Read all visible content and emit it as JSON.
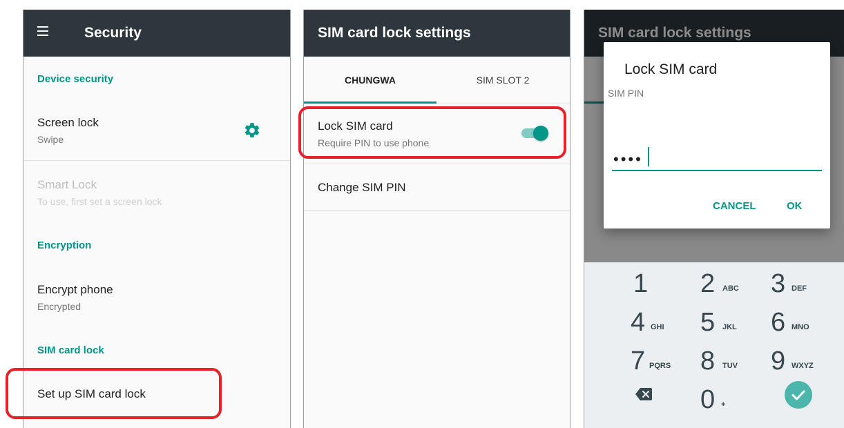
{
  "panel1": {
    "title": "Security",
    "section_device_security": "Device security",
    "screen_lock": {
      "title": "Screen lock",
      "subtitle": "Swipe"
    },
    "smart_lock": {
      "title": "Smart Lock",
      "subtitle": "To use, first set a screen lock"
    },
    "section_encryption": "Encryption",
    "encrypt_phone": {
      "title": "Encrypt phone",
      "subtitle": "Encrypted"
    },
    "section_sim_card_lock": "SIM card lock",
    "set_up_sim_lock": "Set up SIM card lock"
  },
  "panel2": {
    "title": "SIM card lock settings",
    "tabs": [
      {
        "label": "CHUNGWA",
        "selected": true
      },
      {
        "label": "SIM SLOT 2",
        "selected": false
      }
    ],
    "lock_sim": {
      "title": "Lock SIM card",
      "subtitle": "Require PIN to use phone",
      "toggle_on": true
    },
    "change_pin": "Change SIM PIN"
  },
  "panel3": {
    "background_title": "SIM card lock settings",
    "dialog": {
      "title": "Lock SIM card",
      "field_label": "SIM PIN",
      "value": "••••",
      "cancel": "CANCEL",
      "ok": "OK"
    },
    "keypad": {
      "rows": [
        [
          {
            "num": "1",
            "letters": ""
          },
          {
            "num": "2",
            "letters": "ABC"
          },
          {
            "num": "3",
            "letters": "DEF"
          }
        ],
        [
          {
            "num": "4",
            "letters": "GHI"
          },
          {
            "num": "5",
            "letters": "JKL"
          },
          {
            "num": "6",
            "letters": "MNO"
          }
        ],
        [
          {
            "num": "7",
            "letters": "PQRS"
          },
          {
            "num": "8",
            "letters": "TUV"
          },
          {
            "num": "9",
            "letters": "WXYZ"
          }
        ]
      ],
      "zero": "0",
      "zero_sub": "+",
      "backspace_icon": "backspace-icon",
      "done_icon": "check-icon"
    }
  },
  "colors": {
    "appbar": "#2d373d",
    "accent": "#009688",
    "callout": "#e8202a"
  }
}
